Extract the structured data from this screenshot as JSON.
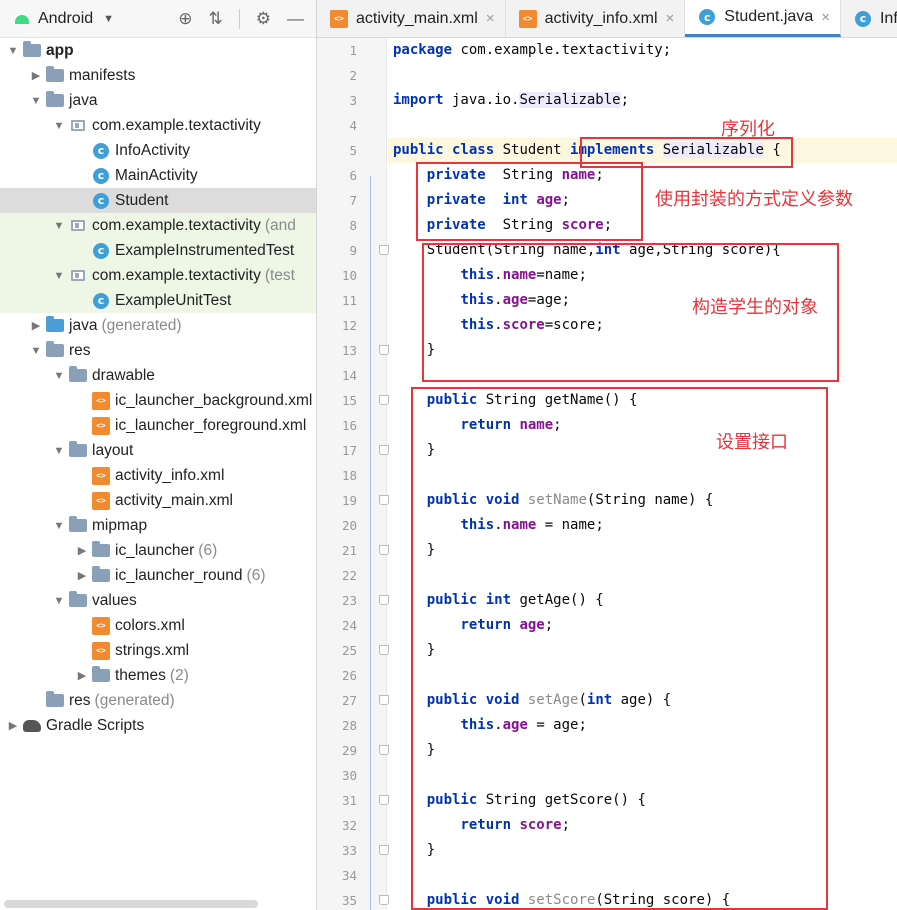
{
  "project_panel": {
    "title": "Android",
    "tree": [
      {
        "label": "app",
        "depth": 0,
        "icon": "folder-icon",
        "expanded": true,
        "bold": true
      },
      {
        "label": "manifests",
        "depth": 1,
        "icon": "folder-icon",
        "expanded": false
      },
      {
        "label": "java",
        "depth": 1,
        "icon": "folder-icon",
        "expanded": true
      },
      {
        "label": "com.example.textactivity",
        "depth": 2,
        "icon": "package-icon",
        "expanded": true
      },
      {
        "label": "InfoActivity",
        "depth": 3,
        "icon": "class-icon"
      },
      {
        "label": "MainActivity",
        "depth": 3,
        "icon": "class-icon"
      },
      {
        "label": "Student",
        "depth": 3,
        "icon": "class-icon",
        "selected": true
      },
      {
        "label": "com.example.textactivity",
        "suffix": "(and",
        "depth": 2,
        "icon": "package-icon",
        "expanded": true,
        "test": true
      },
      {
        "label": "ExampleInstrumentedTest",
        "depth": 3,
        "icon": "test-class-icon",
        "test": true
      },
      {
        "label": "com.example.textactivity",
        "suffix": "(test",
        "depth": 2,
        "icon": "package-icon",
        "expanded": true,
        "test": true
      },
      {
        "label": "ExampleUnitTest",
        "depth": 3,
        "icon": "test-class-icon",
        "test": true
      },
      {
        "label": "java",
        "suffix": "(generated)",
        "depth": 1,
        "icon": "generated-folder-icon",
        "expanded": false
      },
      {
        "label": "res",
        "depth": 1,
        "icon": "folder-icon",
        "expanded": true
      },
      {
        "label": "drawable",
        "depth": 2,
        "icon": "folder-icon",
        "expanded": true
      },
      {
        "label": "ic_launcher_background.xml",
        "depth": 3,
        "icon": "xml-icon"
      },
      {
        "label": "ic_launcher_foreground.xml",
        "depth": 3,
        "icon": "xml-icon"
      },
      {
        "label": "layout",
        "depth": 2,
        "icon": "folder-icon",
        "expanded": true
      },
      {
        "label": "activity_info.xml",
        "depth": 3,
        "icon": "xml-icon"
      },
      {
        "label": "activity_main.xml",
        "depth": 3,
        "icon": "xml-icon"
      },
      {
        "label": "mipmap",
        "depth": 2,
        "icon": "folder-icon",
        "expanded": true
      },
      {
        "label": "ic_launcher",
        "suffix": "(6)",
        "depth": 3,
        "icon": "folder-icon",
        "expanded": false
      },
      {
        "label": "ic_launcher_round",
        "suffix": "(6)",
        "depth": 3,
        "icon": "folder-icon",
        "expanded": false
      },
      {
        "label": "values",
        "depth": 2,
        "icon": "folder-icon",
        "expanded": true
      },
      {
        "label": "colors.xml",
        "depth": 3,
        "icon": "xml-icon"
      },
      {
        "label": "strings.xml",
        "depth": 3,
        "icon": "xml-icon"
      },
      {
        "label": "themes",
        "suffix": "(2)",
        "depth": 3,
        "icon": "folder-icon",
        "expanded": false
      },
      {
        "label": "res",
        "suffix": "(generated)",
        "depth": 1,
        "icon": "folder-icon",
        "noarrow": true
      },
      {
        "label": "Gradle Scripts",
        "depth": 0,
        "icon": "gradle-icon",
        "expanded": false
      }
    ]
  },
  "tabs": [
    {
      "label": "activity_main.xml",
      "icon": "xml-icon",
      "active": false
    },
    {
      "label": "activity_info.xml",
      "icon": "xml-icon",
      "active": false
    },
    {
      "label": "Student.java",
      "icon": "class-icon",
      "active": true
    },
    {
      "label": "Infc",
      "icon": "class-icon",
      "active": false
    }
  ],
  "code_lines": [
    "<span class=\"kw\">package</span> com.example.textactivity;",
    "",
    "<span class=\"kw\">import</span> java.io.<span class=\"ser\">Serializable</span>;",
    "",
    "<span class=\"kw\">public class</span> Student <span class=\"kw\">implements</span> <span class=\"ser\">Serializable</span> {",
    "    <span class=\"kw\">private</span>  String <span class=\"fld\">name</span>;",
    "    <span class=\"kw\">private</span>  <span class=\"kw\">int</span> <span class=\"fld\">age</span>;",
    "    <span class=\"kw\">private</span>  String <span class=\"fld\">score</span>;",
    "    Student(String name,<span class=\"kw\">int</span> age,String score){",
    "        <span class=\"kw\">this</span>.<span class=\"fld\">name</span>=name;",
    "        <span class=\"kw\">this</span>.<span class=\"fld\">age</span>=age;",
    "        <span class=\"kw\">this</span>.<span class=\"fld\">score</span>=score;",
    "    }",
    "",
    "    <span class=\"kw\">public</span> String getName() {",
    "        <span class=\"kw\">return</span> <span class=\"fld\">name</span>;",
    "    }",
    "",
    "    <span class=\"kw\">public void</span> <span class=\"unused\">setName</span>(String name) {",
    "        <span class=\"kw\">this</span>.<span class=\"fld\">name</span> = name;",
    "    }",
    "",
    "    <span class=\"kw\">public int</span> getAge() {",
    "        <span class=\"kw\">return</span> <span class=\"fld\">age</span>;",
    "    }",
    "",
    "    <span class=\"kw\">public void</span> <span class=\"unused\">setAge</span>(<span class=\"kw\">int</span> age) {",
    "        <span class=\"kw\">this</span>.<span class=\"fld\">age</span> = age;",
    "    }",
    "",
    "    <span class=\"kw\">public</span> String getScore() {",
    "        <span class=\"kw\">return</span> <span class=\"fld\">score</span>;",
    "    }",
    "",
    "    <span class=\"kw\">public void</span> <span class=\"unused\">setScore</span>(String score) {"
  ],
  "current_line": 5,
  "fold_lines": [
    9,
    13,
    15,
    17,
    19,
    21,
    23,
    25,
    27,
    29,
    31,
    33,
    35
  ],
  "annotations": {
    "serialize": "序列化",
    "encapsulate": "使用封装的方式定义参数",
    "construct": "构造学生的对象",
    "accessors": "设置接口"
  },
  "colors": {
    "keyword": "#0033b3",
    "field": "#871094",
    "annotation_red": "#e8343a",
    "selection": "#dcdcdc"
  }
}
